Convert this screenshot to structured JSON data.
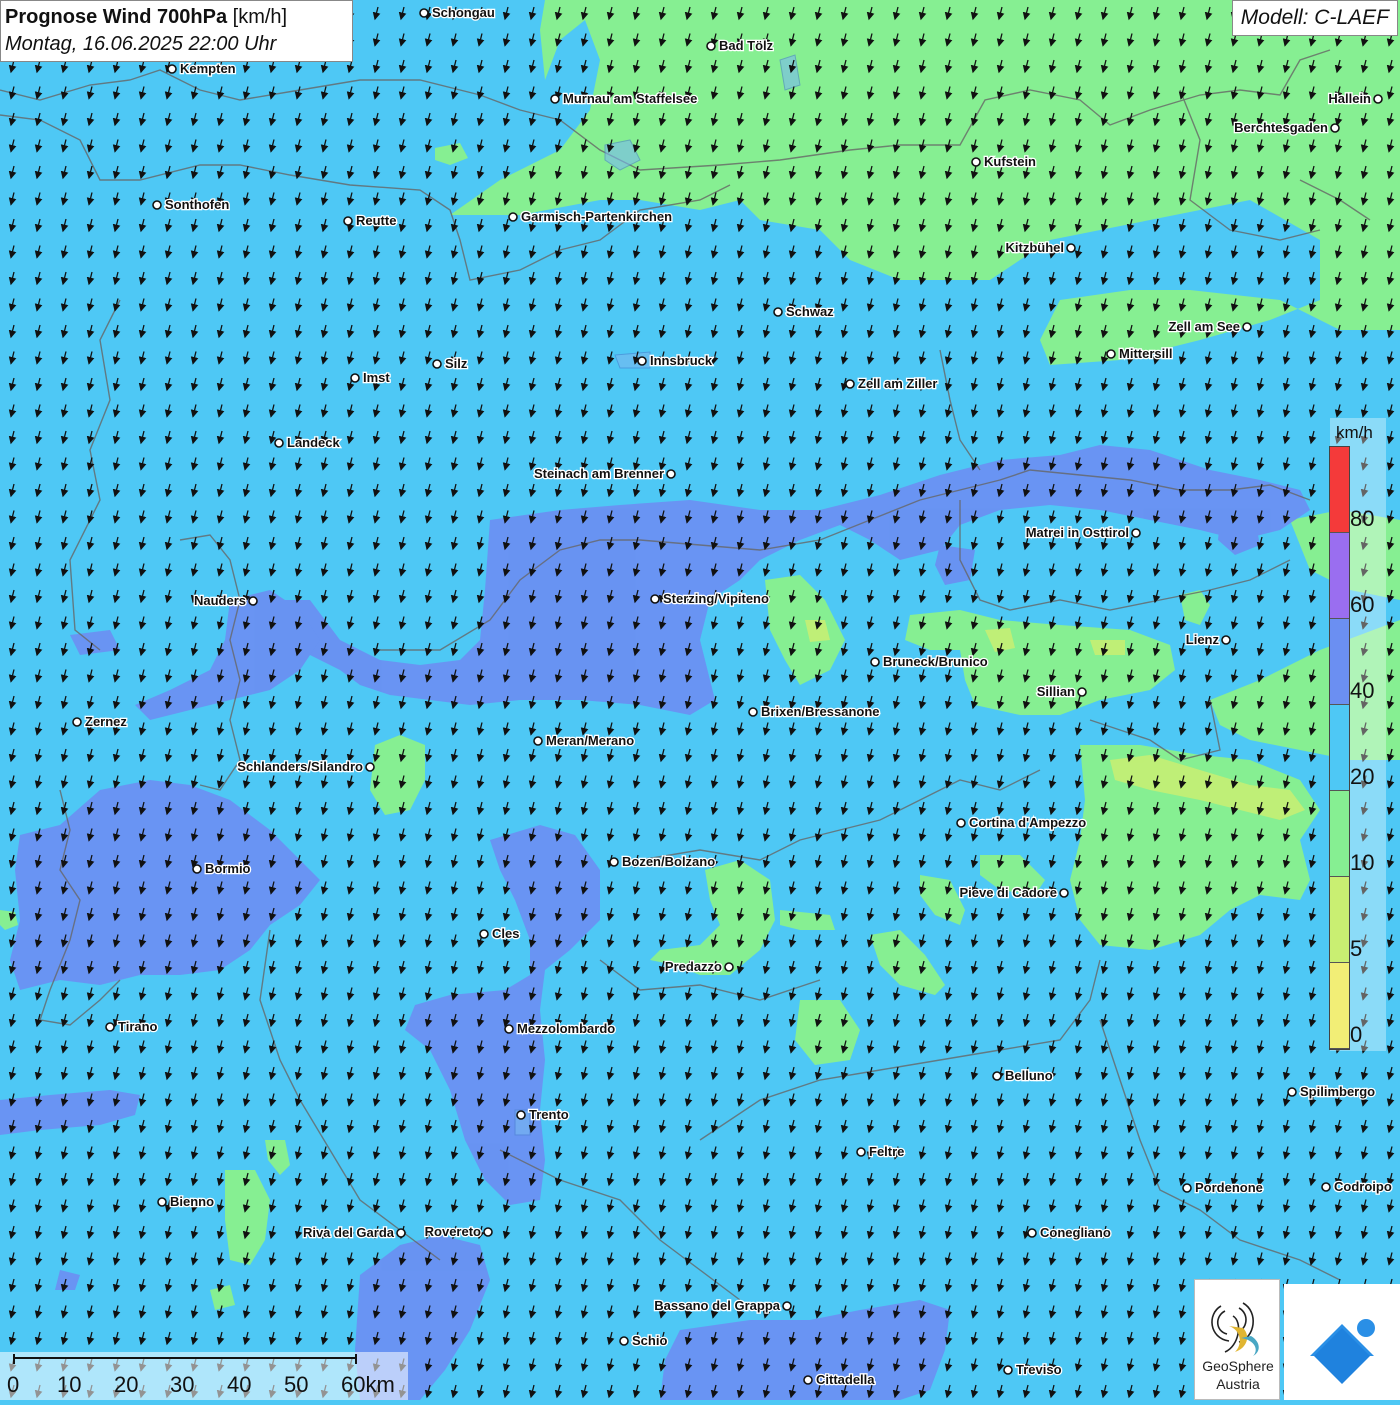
{
  "title": {
    "main": "Prognose Wind 700hPa",
    "unit": "[km/h]",
    "datetime": "Montag, 16.06.2025 22:00 Uhr"
  },
  "model_label": "Modell: C-LAEF",
  "legend": {
    "unit": "km/h",
    "labels": [
      "80",
      "60",
      "40",
      "20",
      "10",
      "5",
      "0"
    ],
    "colors": [
      "#f43a3a",
      "#9a6ef0",
      "#6b8ff2",
      "#4ec8f5",
      "#86ef92",
      "#c9ef72",
      "#f2ee76"
    ]
  },
  "scale_bar": {
    "labels": [
      "0",
      "10",
      "20",
      "30",
      "40",
      "50",
      "60km"
    ]
  },
  "logos": {
    "geosphere_line1": "GeoSphere",
    "geosphere_line2": "Austria"
  },
  "colors": {
    "wind_20_40": "#4ec8f5",
    "wind_40_60": "#6b8ff2",
    "wind_10_20": "#86ef92",
    "wind_5_10": "#c9ef72",
    "background": "#4ec8f5"
  },
  "wind_direction": "from north-northeast (arrows pointing south-southwest)",
  "cities": [
    {
      "name": "Schongau",
      "lbl": "r"
    },
    {
      "name": "Bad Tölz",
      "lbl": "r"
    },
    {
      "name": "Kempten",
      "lbl": "r"
    },
    {
      "name": "Murnau am Staffelsee",
      "lbl": "r"
    },
    {
      "name": "Hallein",
      "lbl": "l"
    },
    {
      "name": "Berchtesgaden",
      "lbl": "l"
    },
    {
      "name": "Kufstein",
      "lbl": "r"
    },
    {
      "name": "Sonthofen",
      "lbl": "r"
    },
    {
      "name": "Reutte",
      "lbl": "r"
    },
    {
      "name": "Garmisch-Partenkirchen",
      "lbl": "r"
    },
    {
      "name": "Kitzbühel",
      "lbl": "l"
    },
    {
      "name": "Schwaz",
      "lbl": "r"
    },
    {
      "name": "Zell am See",
      "lbl": "l"
    },
    {
      "name": "Mittersill",
      "lbl": "r"
    },
    {
      "name": "Innsbruck",
      "lbl": "r"
    },
    {
      "name": "Silz",
      "lbl": "r"
    },
    {
      "name": "Imst",
      "lbl": "r"
    },
    {
      "name": "Zell am Ziller",
      "lbl": "r"
    },
    {
      "name": "Landeck",
      "lbl": "r"
    },
    {
      "name": "Steinach am Brenner",
      "lbl": "l"
    },
    {
      "name": "Matrei in Osttirol",
      "lbl": "l"
    },
    {
      "name": "Nauders",
      "lbl": "l"
    },
    {
      "name": "Sterzing/Vipiteno",
      "lbl": "r"
    },
    {
      "name": "Lienz",
      "lbl": "l"
    },
    {
      "name": "Bruneck/Brunico",
      "lbl": "r"
    },
    {
      "name": "Sillian",
      "lbl": "l"
    },
    {
      "name": "Zernez",
      "lbl": "r"
    },
    {
      "name": "Brixen/Bressanone",
      "lbl": "r"
    },
    {
      "name": "Meran/Merano",
      "lbl": "r"
    },
    {
      "name": "Schlanders/Silandro",
      "lbl": "l"
    },
    {
      "name": "Cortina d'Ampezzo",
      "lbl": "r"
    },
    {
      "name": "Bozen/Bolzano",
      "lbl": "r"
    },
    {
      "name": "Bormio",
      "lbl": "r"
    },
    {
      "name": "Pieve di Cadore",
      "lbl": "l"
    },
    {
      "name": "Cles",
      "lbl": "r"
    },
    {
      "name": "Predazzo",
      "lbl": "l"
    },
    {
      "name": "Tirano",
      "lbl": "r"
    },
    {
      "name": "Mezzolombardo",
      "lbl": "r"
    },
    {
      "name": "Belluno",
      "lbl": "r"
    },
    {
      "name": "Spilimbergo",
      "lbl": "r"
    },
    {
      "name": "Trento",
      "lbl": "r"
    },
    {
      "name": "Feltre",
      "lbl": "r"
    },
    {
      "name": "Pordenone",
      "lbl": "r"
    },
    {
      "name": "Codroipo",
      "lbl": "r"
    },
    {
      "name": "Bienno",
      "lbl": "r"
    },
    {
      "name": "Riva del Garda",
      "lbl": "l"
    },
    {
      "name": "Rovereto",
      "lbl": "l"
    },
    {
      "name": "Conegliano",
      "lbl": "r"
    },
    {
      "name": "Bassano del Grappa",
      "lbl": "l"
    },
    {
      "name": "Schio",
      "lbl": "r"
    },
    {
      "name": "Treviso",
      "lbl": "r"
    },
    {
      "name": "Cittadella",
      "lbl": "r"
    }
  ]
}
